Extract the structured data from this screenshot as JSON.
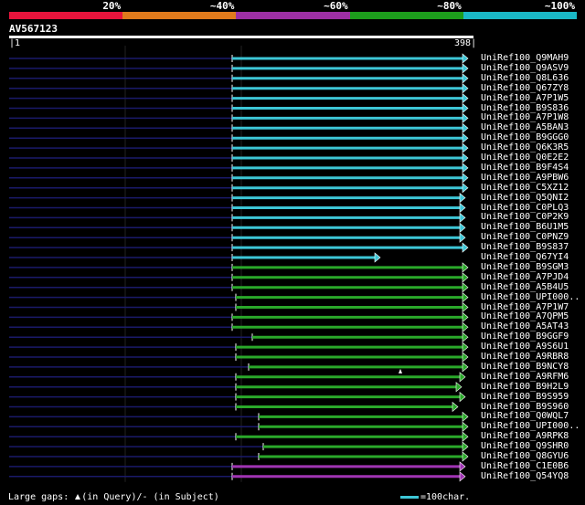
{
  "legend": {
    "colors": [
      "#e8143c",
      "#e07a1c",
      "#9c2fa4",
      "#1d9e1c",
      "#1ab8c6"
    ],
    "labels": [
      "20%",
      "~40%",
      "~60%",
      "~80%",
      "~100%"
    ]
  },
  "query": {
    "id": "AV567123",
    "start": "1",
    "end": "398"
  },
  "hit_colors": {
    "cyan": "#3dc6d6",
    "green": "#2aa82a",
    "purple": "#a034b4",
    "dim": "#1a1a6a"
  },
  "hits": [
    {
      "name": "UniRef100_Q9MAH9",
      "color": "cyan",
      "start": 254,
      "end": 512
    },
    {
      "name": "UniRef100_Q9ASV9",
      "color": "cyan",
      "start": 254,
      "end": 512
    },
    {
      "name": "UniRef100_Q8L636",
      "color": "cyan",
      "start": 254,
      "end": 512
    },
    {
      "name": "UniRef100_Q67ZY8",
      "color": "cyan",
      "start": 254,
      "end": 512
    },
    {
      "name": "UniRef100_A7P1W5",
      "color": "cyan",
      "start": 254,
      "end": 512
    },
    {
      "name": "UniRef100_B9S836",
      "color": "cyan",
      "start": 254,
      "end": 512
    },
    {
      "name": "UniRef100_A7P1W8",
      "color": "cyan",
      "start": 254,
      "end": 512
    },
    {
      "name": "UniRef100_A5BAN3",
      "color": "cyan",
      "start": 254,
      "end": 512
    },
    {
      "name": "UniRef100_B9GGG0",
      "color": "cyan",
      "start": 254,
      "end": 512
    },
    {
      "name": "UniRef100_Q6K3R5",
      "color": "cyan",
      "start": 254,
      "end": 512
    },
    {
      "name": "UniRef100_Q0E2E2",
      "color": "cyan",
      "start": 254,
      "end": 512
    },
    {
      "name": "UniRef100_B9F4S4",
      "color": "cyan",
      "start": 254,
      "end": 512
    },
    {
      "name": "UniRef100_A9PBW6",
      "color": "cyan",
      "start": 254,
      "end": 512
    },
    {
      "name": "UniRef100_C5XZ12",
      "color": "cyan",
      "start": 254,
      "end": 512
    },
    {
      "name": "UniRef100_Q5QNI2",
      "color": "cyan",
      "start": 254,
      "end": 509
    },
    {
      "name": "UniRef100_C0PLQ3",
      "color": "cyan",
      "start": 254,
      "end": 509
    },
    {
      "name": "UniRef100_C0P2K9",
      "color": "cyan",
      "start": 254,
      "end": 509
    },
    {
      "name": "UniRef100_B6U1M5",
      "color": "cyan",
      "start": 254,
      "end": 509
    },
    {
      "name": "UniRef100_C0PNZ9",
      "color": "cyan",
      "start": 254,
      "end": 509
    },
    {
      "name": "UniRef100_B9S837",
      "color": "cyan",
      "start": 254,
      "end": 512
    },
    {
      "name": "UniRef100_Q67YI4",
      "color": "cyan",
      "start": 254,
      "end": 416
    },
    {
      "name": "UniRef100_B9SGM3",
      "color": "green",
      "start": 254,
      "end": 512
    },
    {
      "name": "UniRef100_A7PJD4",
      "color": "green",
      "start": 254,
      "end": 512
    },
    {
      "name": "UniRef100_A5B4U5",
      "color": "green",
      "start": 254,
      "end": 512
    },
    {
      "name": "UniRef100_UPI000..",
      "color": "green",
      "start": 258,
      "end": 512
    },
    {
      "name": "UniRef100_A7P1W7",
      "color": "green",
      "start": 258,
      "end": 512
    },
    {
      "name": "UniRef100_A7QPM5",
      "color": "green",
      "start": 254,
      "end": 512
    },
    {
      "name": "UniRef100_A5AT43",
      "color": "green",
      "start": 254,
      "end": 512
    },
    {
      "name": "UniRef100_B9GGF9",
      "color": "green",
      "start": 276,
      "end": 512
    },
    {
      "name": "UniRef100_A9S6U1",
      "color": "green",
      "start": 258,
      "end": 512
    },
    {
      "name": "UniRef100_A9RBR8",
      "color": "green",
      "start": 258,
      "end": 512
    },
    {
      "name": "UniRef100_B9NCY8",
      "color": "green",
      "start": 272,
      "end": 512
    },
    {
      "name": "UniRef100_A9RFM6",
      "color": "green",
      "start": 258,
      "end": 509
    },
    {
      "name": "UniRef100_B9H2L9",
      "color": "green",
      "start": 258,
      "end": 505
    },
    {
      "name": "UniRef100_B9S959",
      "color": "green",
      "start": 258,
      "end": 509
    },
    {
      "name": "UniRef100_B9S960",
      "color": "green",
      "start": 258,
      "end": 501
    },
    {
      "name": "UniRef100_Q0WQL7",
      "color": "green",
      "start": 283,
      "end": 512
    },
    {
      "name": "UniRef100_UPI000..",
      "color": "green",
      "start": 283,
      "end": 512
    },
    {
      "name": "UniRef100_A9RPK8",
      "color": "green",
      "start": 258,
      "end": 512
    },
    {
      "name": "UniRef100_Q9SHR0",
      "color": "green",
      "start": 288,
      "end": 512
    },
    {
      "name": "UniRef100_Q8GYU6",
      "color": "green",
      "start": 283,
      "end": 512
    },
    {
      "name": "UniRef100_C1E0B6",
      "color": "purple",
      "start": 254,
      "end": 509
    },
    {
      "name": "UniRef100_Q54YQ8",
      "color": "purple",
      "start": 254,
      "end": 509
    }
  ],
  "footer": {
    "gaps_prefix": "Large gaps:",
    "gaps_suffix": "(in Query)/- (in Subject)",
    "scale_label": "=100char."
  }
}
